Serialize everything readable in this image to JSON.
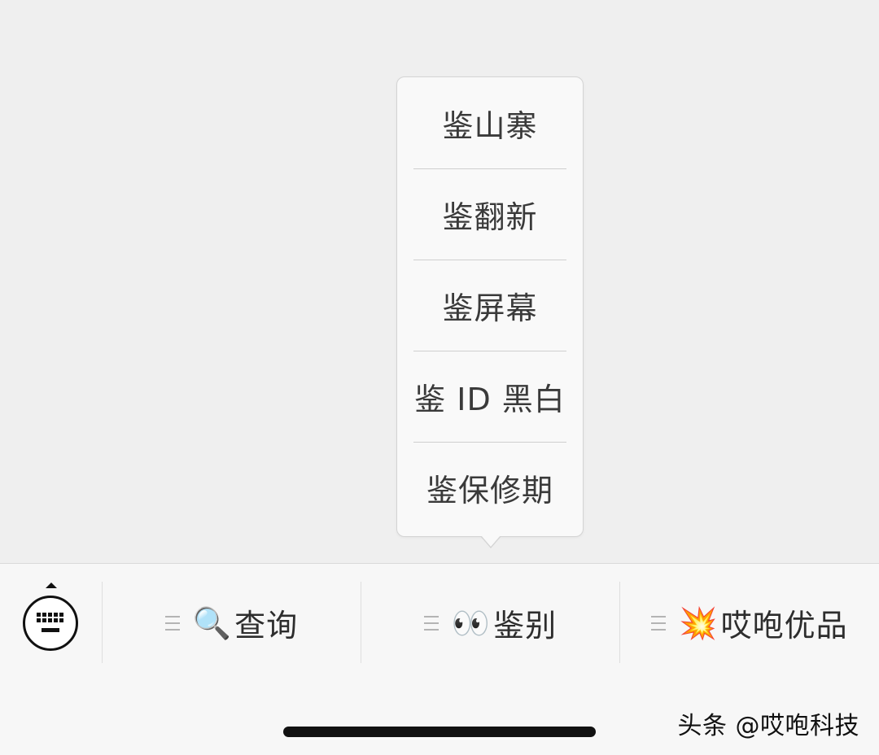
{
  "popup_menu": {
    "items": [
      {
        "label": "鉴山寨"
      },
      {
        "label": "鉴翻新"
      },
      {
        "label": "鉴屏幕"
      },
      {
        "label": "鉴 ID 黑白"
      },
      {
        "label": "鉴保修期"
      }
    ]
  },
  "menu_bar": {
    "keyboard_icon": "keyboard-icon",
    "tabs": [
      {
        "icon": "magnifier-icon",
        "emoji": "🔍",
        "label": "查询"
      },
      {
        "icon": "eyes-icon",
        "emoji": "👀",
        "label": "鉴别"
      },
      {
        "icon": "collision-icon",
        "emoji": "💥",
        "label": "哎咆优品"
      }
    ]
  },
  "watermark": {
    "text": "头条 @哎咆科技"
  }
}
